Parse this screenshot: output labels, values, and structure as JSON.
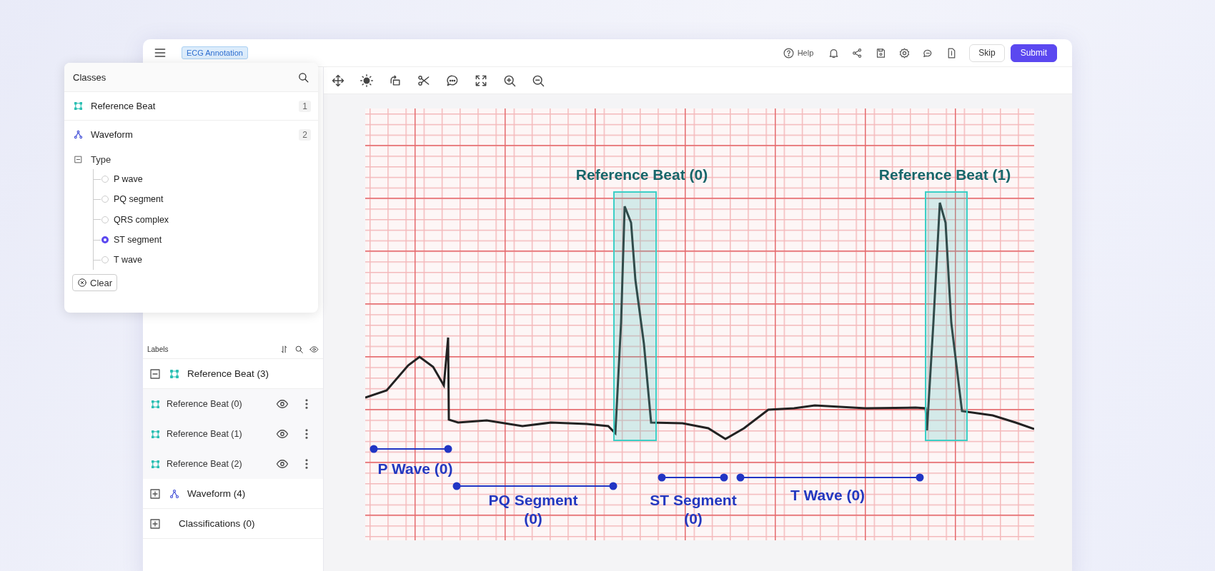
{
  "topbar": {
    "title_badge": "ECG Annotation",
    "help": "Help",
    "buttons": [
      {
        "label": "Skip",
        "kind": "secondary"
      },
      {
        "label": "Submit",
        "kind": "primary"
      }
    ]
  },
  "classes_panel": {
    "title": "Classes",
    "classes": [
      {
        "name": "Reference Beat",
        "count": "1",
        "kind": "box"
      },
      {
        "name": "Waveform",
        "count": "2",
        "kind": "polyline"
      }
    ],
    "type": {
      "label": "Type",
      "expanded": true,
      "options": [
        {
          "label": "P wave",
          "selected": false
        },
        {
          "label": "PQ segment",
          "selected": false
        },
        {
          "label": "QRS complex",
          "selected": false
        },
        {
          "label": "ST segment",
          "selected": true
        },
        {
          "label": "T wave",
          "selected": false
        }
      ],
      "clear_button": "Clear"
    }
  },
  "labels_panel": {
    "title": "Labels",
    "groups": [
      {
        "name": "Reference Beat (3)",
        "kind": "box",
        "expanded": true,
        "children": [
          {
            "name": "Reference Beat (0)"
          },
          {
            "name": "Reference Beat (1)"
          },
          {
            "name": "Reference Beat (2)"
          }
        ]
      },
      {
        "name": "Waveform (4)",
        "kind": "polyline",
        "expanded": false
      },
      {
        "name": "Classifications (0)",
        "kind": "classification",
        "expanded": false
      }
    ]
  },
  "canvas": {
    "annotations": [
      {
        "kind": "box",
        "label": "Reference Beat (0)"
      },
      {
        "kind": "box",
        "label": "Reference Beat (1)"
      },
      {
        "kind": "segment",
        "label": "P Wave (0)"
      },
      {
        "kind": "segment",
        "label": "PQ Segment (0)"
      },
      {
        "kind": "segment",
        "label": "ST Segment (0)"
      },
      {
        "kind": "segment",
        "label": "T Wave (0)"
      }
    ]
  }
}
